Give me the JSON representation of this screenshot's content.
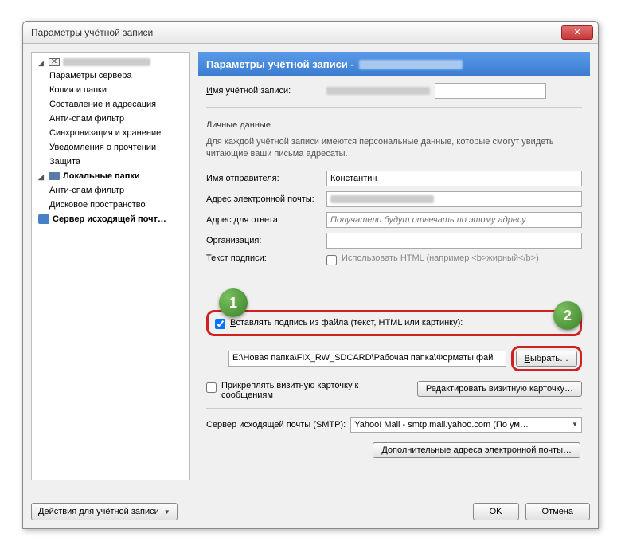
{
  "window": {
    "title": "Параметры учётной записи"
  },
  "sidebar": {
    "account_redacted_width": 110,
    "items": [
      "Параметры сервера",
      "Копии и папки",
      "Составление и адресация",
      "Анти-спам фильтр",
      "Синхронизация и хранение",
      "Уведомления о прочтении",
      "Защита"
    ],
    "local_folders": "Локальные папки",
    "local_items": [
      "Анти-спам фильтр",
      "Дисковое пространство"
    ],
    "outgoing_server": "Сервер исходящей почт…",
    "actions_button": "Действия для учётной записи"
  },
  "main": {
    "header": "Параметры учётной записи -",
    "account_name_label": "Имя учётной записи:",
    "personal_label": "Личные данные",
    "personal_help": "Для каждой учётной записи имеются персональные данные, которые смогут увидеть читающие ваши письма адресаты.",
    "sender_name_label": "Имя отправителя:",
    "sender_name_value": "Константин",
    "email_label": "Адрес электронной почты:",
    "reply_label": "Адрес для ответа:",
    "reply_placeholder": "Получатели будут отвечать по этому адресу",
    "org_label": "Организация:",
    "sig_text_label": "Текст подписи:",
    "use_html_label": "Использовать HTML (например <b>жирный</b>)",
    "sig_file_label": "Вставлять подпись из файла (текст, HTML или картинку):",
    "file_path": "E:\\Новая папка\\FIX_RW_SDCARD\\Рабочая папка\\Форматы фай",
    "choose_button": "Выбрать…",
    "vcard_label": "Прикреплять визитную карточку к сообщениям",
    "edit_vcard_button": "Редактировать визитную карточку…",
    "smtp_label": "Сервер исходящей почты (SMTP):",
    "smtp_value": "Yahoo! Mail - smtp.mail.yahoo.com (По ум…",
    "extra_addresses_button": "Дополнительные адреса электронной почты…"
  },
  "footer": {
    "ok": "OK",
    "cancel": "Отмена"
  },
  "callouts": {
    "one": "1",
    "two": "2"
  }
}
